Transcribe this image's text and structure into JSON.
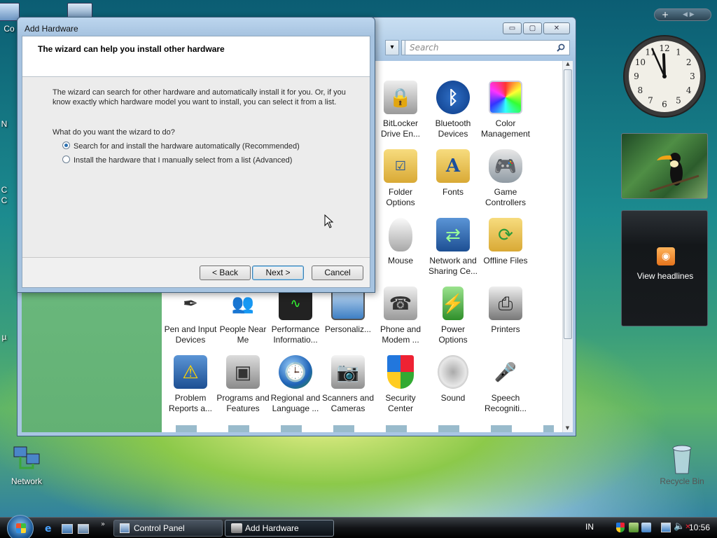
{
  "desktop": {
    "icons": [
      {
        "label": "Network"
      },
      {
        "label": "Recycle Bin"
      }
    ],
    "edge_labels": [
      "Co",
      "N",
      "C",
      "C",
      "µ"
    ]
  },
  "control_panel": {
    "search_placeholder": "Search",
    "title_buttons": {
      "minimize": "▭",
      "maximize": "▢",
      "close": "✕"
    },
    "items": [
      {
        "label": "BitLocker Drive En...",
        "icon": "bitlocker-icon"
      },
      {
        "label": "Bluetooth Devices",
        "icon": "bluetooth-icon"
      },
      {
        "label": "Color Management",
        "icon": "color-management-icon"
      },
      {
        "label": "Folder Options",
        "icon": "folder-options-icon"
      },
      {
        "label": "Fonts",
        "icon": "fonts-icon"
      },
      {
        "label": "Game Controllers",
        "icon": "game-controller-icon"
      },
      {
        "label": "Mouse",
        "icon": "mouse-icon"
      },
      {
        "label": "Network and Sharing Ce...",
        "icon": "network-sharing-icon"
      },
      {
        "label": "Offline Files",
        "icon": "offline-files-icon"
      },
      {
        "label": "Pen and Input Devices",
        "icon": "pen-icon"
      },
      {
        "label": "People Near Me",
        "icon": "people-icon"
      },
      {
        "label": "Performance Informatio...",
        "icon": "performance-icon"
      },
      {
        "label": "Personaliz...",
        "icon": "personalize-icon"
      },
      {
        "label": "Phone and Modem ...",
        "icon": "phone-icon"
      },
      {
        "label": "Power Options",
        "icon": "power-icon"
      },
      {
        "label": "Printers",
        "icon": "printer-icon"
      },
      {
        "label": "Problem Reports a...",
        "icon": "problem-reports-icon"
      },
      {
        "label": "Programs and Features",
        "icon": "programs-icon"
      },
      {
        "label": "Regional and Language ...",
        "icon": "regional-icon"
      },
      {
        "label": "Scanners and Cameras",
        "icon": "scanner-icon"
      },
      {
        "label": "Security Center",
        "icon": "security-shield-icon"
      },
      {
        "label": "Sound",
        "icon": "speaker-icon"
      },
      {
        "label": "Speech Recogniti...",
        "icon": "microphone-icon"
      }
    ]
  },
  "wizard": {
    "title": "Add Hardware",
    "heading": "The wizard can help you install other hardware",
    "description": "The wizard can search for other hardware and automatically install it for you. Or, if you know exactly which hardware model you want to install, you can select it from a list.",
    "question": "What do you want the wizard to do?",
    "options": [
      {
        "label": "Search for and install the hardware automatically (Recommended)",
        "selected": true
      },
      {
        "label": "Install the hardware that I manually select from a list (Advanced)",
        "selected": false
      }
    ],
    "buttons": {
      "back": "< Back",
      "next": "Next >",
      "cancel": "Cancel"
    }
  },
  "sidebar": {
    "controls": "+",
    "feed_label": "View headlines",
    "clock": {
      "hour": 11,
      "minute": 56
    },
    "clock_numbers": [
      "12",
      "1",
      "2",
      "3",
      "4",
      "5",
      "6",
      "7",
      "8",
      "9",
      "10",
      "11"
    ]
  },
  "taskbar": {
    "buttons": [
      {
        "label": "Control Panel"
      },
      {
        "label": "Add Hardware"
      }
    ],
    "language": "IN",
    "time": "10:56",
    "accent": "#3c7fb1"
  }
}
